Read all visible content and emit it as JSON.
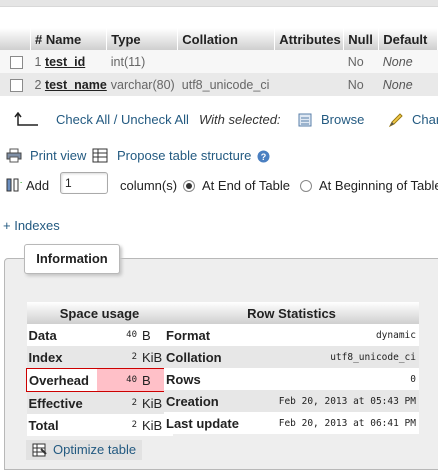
{
  "structure": {
    "headers": {
      "num": "#",
      "name": "Name",
      "type": "Type",
      "collation": "Collation",
      "attributes": "Attributes",
      "null": "Null",
      "default": "Default"
    },
    "rows": [
      {
        "num": "1",
        "name": "test_id",
        "type": "int(11)",
        "collation": "",
        "attributes": "",
        "null": "No",
        "default": "None"
      },
      {
        "num": "2",
        "name": "test_name",
        "type": "varchar(80)",
        "collation": "utf8_unicode_ci",
        "attributes": "",
        "null": "No",
        "default": "None"
      }
    ]
  },
  "bulk": {
    "check_all": "Check All / Uncheck All",
    "with_selected": "With selected:",
    "browse": "Browse",
    "change": "Char"
  },
  "links": {
    "print_view": "Print view",
    "propose": "Propose table structure"
  },
  "add_columns": {
    "add_label": "Add",
    "count": "1",
    "columns_label": "column(s)",
    "at_end": "At End of Table",
    "at_beginning": "At Beginning of Table"
  },
  "indexes_link": "+ Indexes",
  "information": {
    "legend": "Information",
    "space_usage": {
      "title": "Space usage",
      "rows": [
        {
          "label": "Data",
          "value": "40",
          "unit": "B"
        },
        {
          "label": "Index",
          "value": "2",
          "unit": "KiB"
        },
        {
          "label": "Overhead",
          "value": "40",
          "unit": "B"
        },
        {
          "label": "Effective",
          "value": "2",
          "unit": "KiB"
        },
        {
          "label": "Total",
          "value": "2",
          "unit": "KiB"
        }
      ],
      "optimize": "Optimize table"
    },
    "row_statistics": {
      "title": "Row Statistics",
      "rows": [
        {
          "label": "Format",
          "value": "dynamic"
        },
        {
          "label": "Collation",
          "value": "utf8_unicode_ci"
        },
        {
          "label": "Rows",
          "value": "0"
        },
        {
          "label": "Creation",
          "value": "Feb 20, 2013 at 05:43 PM"
        },
        {
          "label": "Last update",
          "value": "Feb 20, 2013 at 06:41 PM"
        }
      ]
    }
  }
}
